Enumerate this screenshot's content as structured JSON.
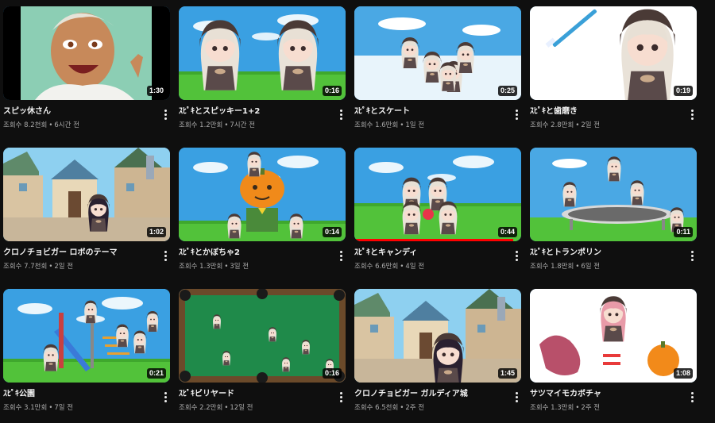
{
  "videos": [
    {
      "title": "スピッ休さん",
      "views": "조회수 8.2천회",
      "age": "6시간 전",
      "duration": "1:30",
      "progress": 0,
      "scene": "cartoon-man"
    },
    {
      "title": "ｽﾋﾟｷとスピッキー1+2",
      "views": "조회수 1.2만회",
      "age": "7시간 전",
      "duration": "0:16",
      "progress": 0,
      "scene": "two-girls"
    },
    {
      "title": "ｽﾋﾟｷとスケート",
      "views": "조회수 1.6만회",
      "age": "1일 전",
      "duration": "0:25",
      "progress": 0,
      "scene": "skate"
    },
    {
      "title": "ｽﾋﾟｷと歯磨き",
      "views": "조회수 2.8만회",
      "age": "2일 전",
      "duration": "0:19",
      "progress": 0,
      "scene": "toothbrush"
    },
    {
      "title": "クロノチョビガー ロボのテーマ",
      "views": "조회수 7.7천회",
      "age": "2일 전",
      "duration": "1:02",
      "progress": 0,
      "scene": "town"
    },
    {
      "title": "ｽﾋﾟｷとかぼちゃ2",
      "views": "조회수 1.3만회",
      "age": "3일 전",
      "duration": "0:14",
      "progress": 0,
      "scene": "pumpkin-head"
    },
    {
      "title": "ｽﾋﾟｷとキャンディ",
      "views": "조회수 6.6만회",
      "age": "4일 전",
      "duration": "0:44",
      "progress": 0.95,
      "scene": "candy"
    },
    {
      "title": "ｽﾋﾟｷとトランポリン",
      "views": "조회수 1.8만회",
      "age": "6일 전",
      "duration": "0:11",
      "progress": 0,
      "scene": "trampoline"
    },
    {
      "title": "ｽﾋﾟｷ公園",
      "views": "조회수 3.1만회",
      "age": "7일 전",
      "duration": "0:21",
      "progress": 0,
      "scene": "park"
    },
    {
      "title": "ｽﾋﾟｷビリヤード",
      "views": "조회수 2.2만회",
      "age": "12일 전",
      "duration": "0:16",
      "progress": 0,
      "scene": "billiards"
    },
    {
      "title": "クロノチョビガー ガルディア城",
      "views": "조회수 6.5천회",
      "age": "2주 전",
      "duration": "1:45",
      "progress": 0,
      "scene": "town-girl"
    },
    {
      "title": "サツマイモカボチャ",
      "views": "조회수 1.3만회",
      "age": "2주 전",
      "duration": "1:08",
      "progress": 0,
      "scene": "sweet-potato"
    }
  ],
  "stats_separator": "•",
  "colors": {
    "background": "#0f0f0f",
    "sky": "#3a9fe0",
    "grass": "#4fbf3a",
    "progress": "#ff0000",
    "meta_text": "#aaaaaa"
  }
}
